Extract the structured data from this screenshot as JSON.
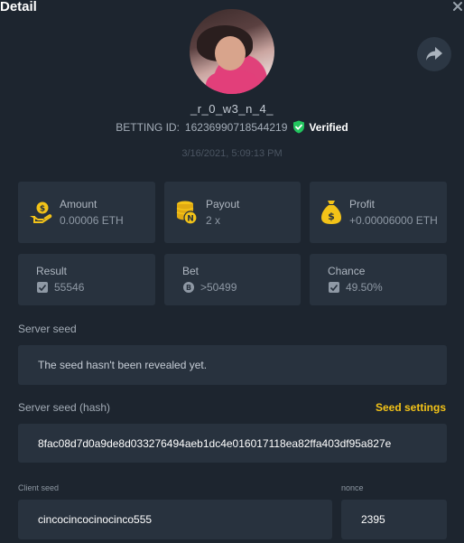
{
  "header": {
    "title": "Detail",
    "close_icon": "close-icon"
  },
  "profile": {
    "username": "_r_0_w3_n_4_",
    "betting_id_label": "BETTING ID:",
    "betting_id": "16236990718544219",
    "verified_label": "Verified",
    "timestamp": "3/16/2021, 5:09:13 PM"
  },
  "stats": {
    "amount": {
      "label": "Amount",
      "value": "0.00006 ETH",
      "icon": "hand-coin-icon"
    },
    "payout": {
      "label": "Payout",
      "value": "2 x",
      "icon": "coin-stack-icon"
    },
    "profit": {
      "label": "Profit",
      "value": "+0.00006000 ETH",
      "icon": "money-bag-icon"
    }
  },
  "results": {
    "result": {
      "label": "Result",
      "value": "55546"
    },
    "bet": {
      "label": "Bet",
      "value": ">50499"
    },
    "chance": {
      "label": "Chance",
      "value": "49.50%"
    }
  },
  "server_seed": {
    "label": "Server seed",
    "value": "The seed hasn't been revealed yet."
  },
  "server_seed_hash": {
    "label": "Server seed (hash)",
    "settings_label": "Seed settings",
    "value": "8fac08d7d0a9de8d033276494aeb1dc4e016017118ea82ffa403df95a827e"
  },
  "client_seed": {
    "label": "Client seed",
    "value": "cincocincocinocinco555"
  },
  "nonce": {
    "label": "nonce",
    "value": "2395"
  },
  "colors": {
    "accent": "#f3c318",
    "verified": "#22c55e",
    "background": "#1d252f",
    "card": "#28323e"
  }
}
